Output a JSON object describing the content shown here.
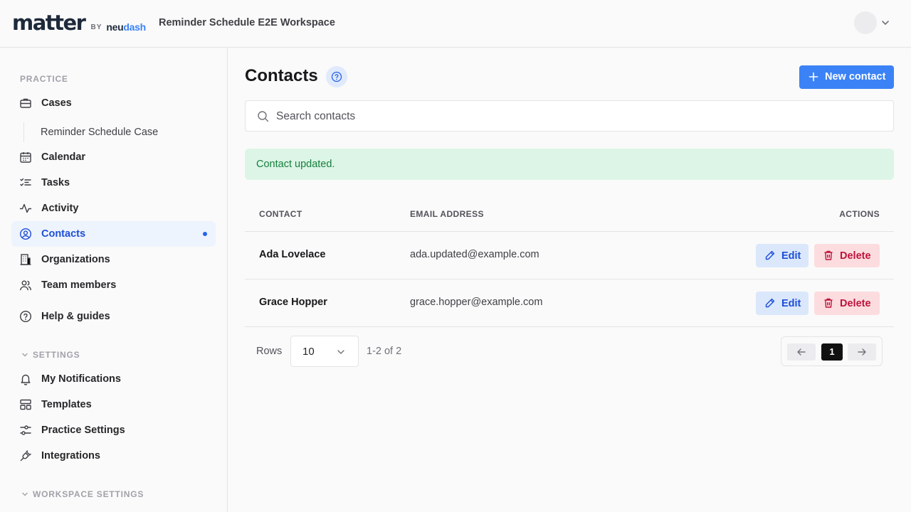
{
  "header": {
    "logo_main": "matter",
    "logo_by": "BY",
    "logo_brand_a": "neu",
    "logo_brand_b": "dash",
    "workspace_title": "Reminder Schedule E2E Workspace"
  },
  "sidebar": {
    "practice_label": "PRACTICE",
    "settings_label": "SETTINGS",
    "workspace_settings_label": "WORKSPACE SETTINGS",
    "practice_items": [
      {
        "label": "Cases",
        "icon": "briefcase-icon"
      },
      {
        "label": "Calendar",
        "icon": "calendar-icon"
      },
      {
        "label": "Tasks",
        "icon": "tasks-icon"
      },
      {
        "label": "Activity",
        "icon": "activity-icon"
      },
      {
        "label": "Contacts",
        "icon": "contacts-icon",
        "active": true
      },
      {
        "label": "Organizations",
        "icon": "building-icon"
      },
      {
        "label": "Team members",
        "icon": "team-icon"
      },
      {
        "label": "Help & guides",
        "icon": "help-icon"
      }
    ],
    "sub_item": "Reminder Schedule Case",
    "settings_items": [
      {
        "label": "My Notifications",
        "icon": "bell-icon"
      },
      {
        "label": "Templates",
        "icon": "templates-icon"
      },
      {
        "label": "Practice Settings",
        "icon": "sliders-icon"
      },
      {
        "label": "Integrations",
        "icon": "plug-icon"
      }
    ]
  },
  "main": {
    "title": "Contacts",
    "new_button": "New contact",
    "search_placeholder": "Search contacts",
    "toast": "Contact updated.",
    "columns": [
      "CONTACT",
      "EMAIL ADDRESS",
      "ACTIONS"
    ],
    "rows": [
      {
        "name": "Ada Lovelace",
        "email": "ada.updated@example.com"
      },
      {
        "name": "Grace Hopper",
        "email": "grace.hopper@example.com"
      }
    ],
    "edit_label": "Edit",
    "delete_label": "Delete",
    "rows_label": "Rows",
    "rows_per_page": "10",
    "range_text": "1-2 of 2",
    "current_page": "1"
  },
  "colors": {
    "accent": "#3b82f6",
    "active_bg": "#eef4fd",
    "success_bg": "#dcf5e6",
    "success_text": "#15803d",
    "danger_bg": "#fcdcdf",
    "danger_text": "#be123c"
  }
}
